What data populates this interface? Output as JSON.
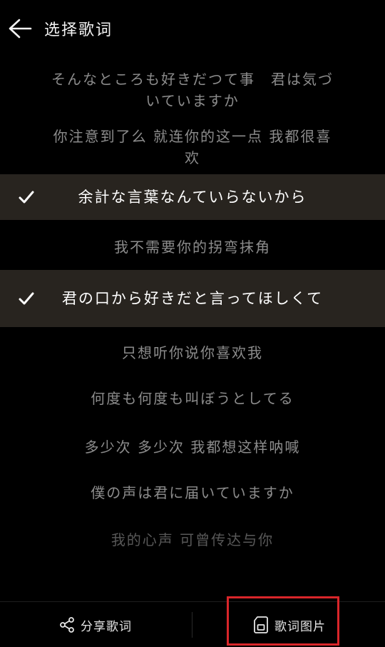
{
  "header": {
    "title": "选择歌词"
  },
  "lyrics": [
    {
      "text": "そんなところも好きだつて事　君は気づいていますか",
      "selected": false
    },
    {
      "text": "你注意到了么 就连你的这一点 我都很喜欢",
      "selected": false
    },
    {
      "text": "余計な言葉なんていらないから",
      "selected": true
    },
    {
      "text": "我不需要你的拐弯抹角",
      "selected": false
    },
    {
      "text": "君の口から好きだと言ってほしくて",
      "selected": true
    },
    {
      "text": "只想听你说你喜欢我",
      "selected": false
    },
    {
      "text": "何度も何度も叫ぼうとしてる",
      "selected": false
    },
    {
      "text": "多少次 多少次 我都想这样呐喊",
      "selected": false
    },
    {
      "text": "僕の声は君に届いていますか",
      "selected": false
    },
    {
      "text": "我的心声 可曾传达与你",
      "selected": false
    }
  ],
  "bottom": {
    "share_label": "分享歌词",
    "image_label": "歌词图片"
  },
  "colors": {
    "background": "#000000",
    "selected_row": "#28241f",
    "highlight": "#d9262a"
  },
  "icons": {
    "back": "arrow-left-icon",
    "check": "check-icon",
    "share": "share-icon",
    "image": "image-card-icon"
  }
}
